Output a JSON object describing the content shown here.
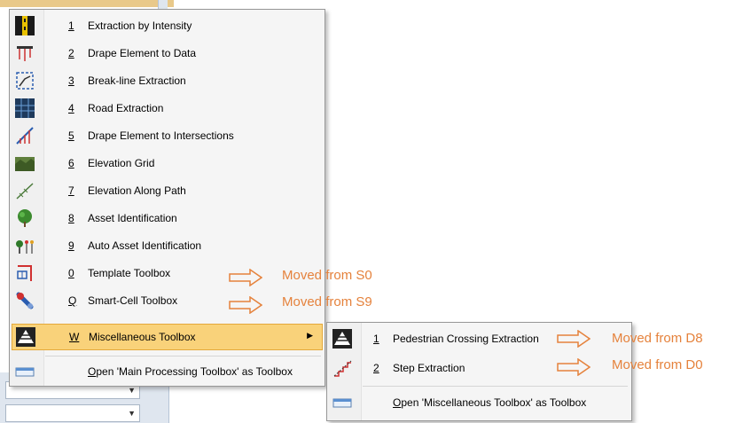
{
  "menu": {
    "items": [
      {
        "num": "1",
        "label": "Extraction by Intensity",
        "icon": "intensity-icon"
      },
      {
        "num": "2",
        "label": "Drape Element to Data",
        "icon": "drape-data-icon"
      },
      {
        "num": "3",
        "label": "Break-line Extraction",
        "icon": "break-line-icon"
      },
      {
        "num": "4",
        "label": "Road Extraction",
        "icon": "road-icon"
      },
      {
        "num": "5",
        "label": "Drape Element to Intersections",
        "icon": "drape-intersections-icon"
      },
      {
        "num": "6",
        "label": "Elevation Grid",
        "icon": "elevation-grid-icon"
      },
      {
        "num": "7",
        "label": "Elevation Along Path",
        "icon": "elevation-path-icon"
      },
      {
        "num": "8",
        "label": "Asset Identification",
        "icon": "tree-icon"
      },
      {
        "num": "9",
        "label": "Auto Asset Identification",
        "icon": "auto-asset-icon"
      },
      {
        "num": "0",
        "label": "Template Toolbox",
        "icon": "template-icon"
      },
      {
        "num": "Q",
        "label": "Smart-Cell Toolbox",
        "icon": "smart-cell-icon"
      },
      {
        "num": "W",
        "label": "Miscellaneous Toolbox",
        "icon": "misc-toolbox-icon"
      }
    ],
    "open_toolbox": {
      "key": "O",
      "rest": "pen 'Main Processing Toolbox' as Toolbox"
    }
  },
  "submenu": {
    "items": [
      {
        "num": "1",
        "label": "Pedestrian Crossing Extraction",
        "icon": "pedestrian-icon"
      },
      {
        "num": "2",
        "label": "Step Extraction",
        "icon": "step-icon"
      }
    ],
    "open_toolbox": {
      "key": "O",
      "rest": "pen 'Miscellaneous Toolbox' as Toolbox"
    }
  },
  "annotations": {
    "s0": "Moved from S0",
    "s9": "Moved from S9",
    "d8": "Moved from D8",
    "d0": "Moved from D0"
  },
  "colors": {
    "highlight": "#f9d27a",
    "annotation": "#e5823c"
  }
}
